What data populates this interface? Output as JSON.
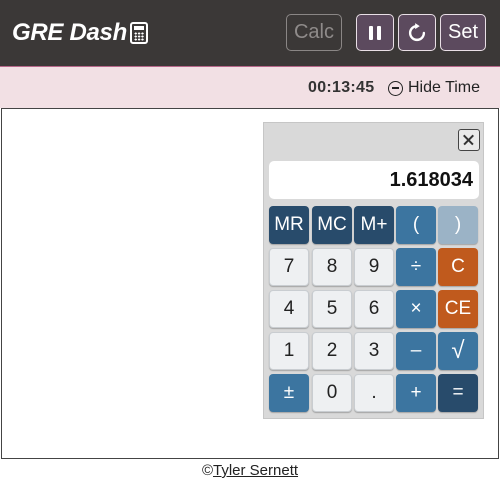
{
  "header": {
    "title": "GRE Dash",
    "calc_label": "Calc",
    "set_label": "Set"
  },
  "timer": {
    "value": "00:13:45",
    "hide_label": "Hide Time"
  },
  "calculator": {
    "display": "1.618034",
    "keys": {
      "mr": "MR",
      "mc": "MC",
      "mplus": "M+",
      "lparen": "(",
      "rparen": ")",
      "n7": "7",
      "n8": "8",
      "n9": "9",
      "div": "÷",
      "c": "C",
      "n4": "4",
      "n5": "5",
      "n6": "6",
      "mul": "×",
      "ce": "CE",
      "n1": "1",
      "n2": "2",
      "n3": "3",
      "minus": "–",
      "sqrt": "√",
      "pm": "±",
      "n0": "0",
      "dot": ".",
      "plus": "+",
      "eq": "="
    }
  },
  "footer": {
    "copyright_symbol": "©",
    "author": "Tyler Sernett"
  },
  "colors": {
    "topbar": "#3b3837",
    "accent_button": "#5c4a5e",
    "timerbar": "#f2e0e4",
    "memory_key": "#284b6b",
    "operator_key": "#3c75a0",
    "clear_key": "#c05a1d"
  }
}
